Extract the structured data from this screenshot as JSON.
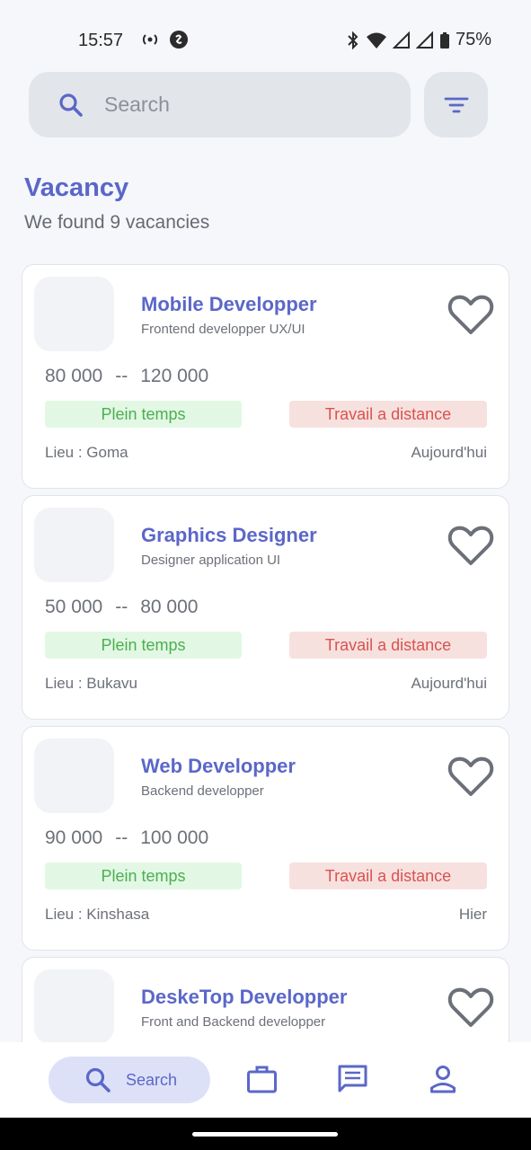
{
  "status_bar": {
    "time": "15:57",
    "battery": "75%"
  },
  "search": {
    "placeholder": "Search"
  },
  "header": {
    "title": "Vacancy",
    "subtitle": "We found 9 vacancies"
  },
  "jobs": [
    {
      "title": "Mobile Developper",
      "subtitle": "Frontend developper UX/UI",
      "salary_min": "80 000",
      "separator": "--",
      "salary_max": "120 000",
      "tag_type": "Plein temps",
      "tag_mode": "Travail a distance",
      "location": "Lieu : Goma",
      "date": "Aujourd'hui"
    },
    {
      "title": "Graphics Designer",
      "subtitle": "Designer application UI",
      "salary_min": "50 000",
      "separator": "--",
      "salary_max": "80 000",
      "tag_type": "Plein temps",
      "tag_mode": "Travail a distance",
      "location": "Lieu : Bukavu",
      "date": "Aujourd'hui"
    },
    {
      "title": "Web Developper",
      "subtitle": "Backend developper",
      "salary_min": "90 000",
      "separator": "--",
      "salary_max": "100 000",
      "tag_type": "Plein temps",
      "tag_mode": "Travail a distance",
      "location": "Lieu : Kinshasa",
      "date": "Hier"
    },
    {
      "title": "DeskeTop Developper",
      "subtitle": "Front and Backend developper",
      "salary_min": "",
      "separator": "",
      "salary_max": "",
      "tag_type": "",
      "tag_mode": "",
      "location": "",
      "date": ""
    }
  ],
  "bottom_nav": {
    "search_label": "Search"
  },
  "colors": {
    "accent": "#5b67c8",
    "tag_green_bg": "#e2f8e4",
    "tag_green_text": "#4caf50",
    "tag_red_bg": "#f7e1df",
    "tag_red_text": "#d9534f"
  },
  "icons": [
    "search-icon",
    "filter-icon",
    "heart-icon",
    "briefcase-icon",
    "chat-icon",
    "person-icon"
  ]
}
